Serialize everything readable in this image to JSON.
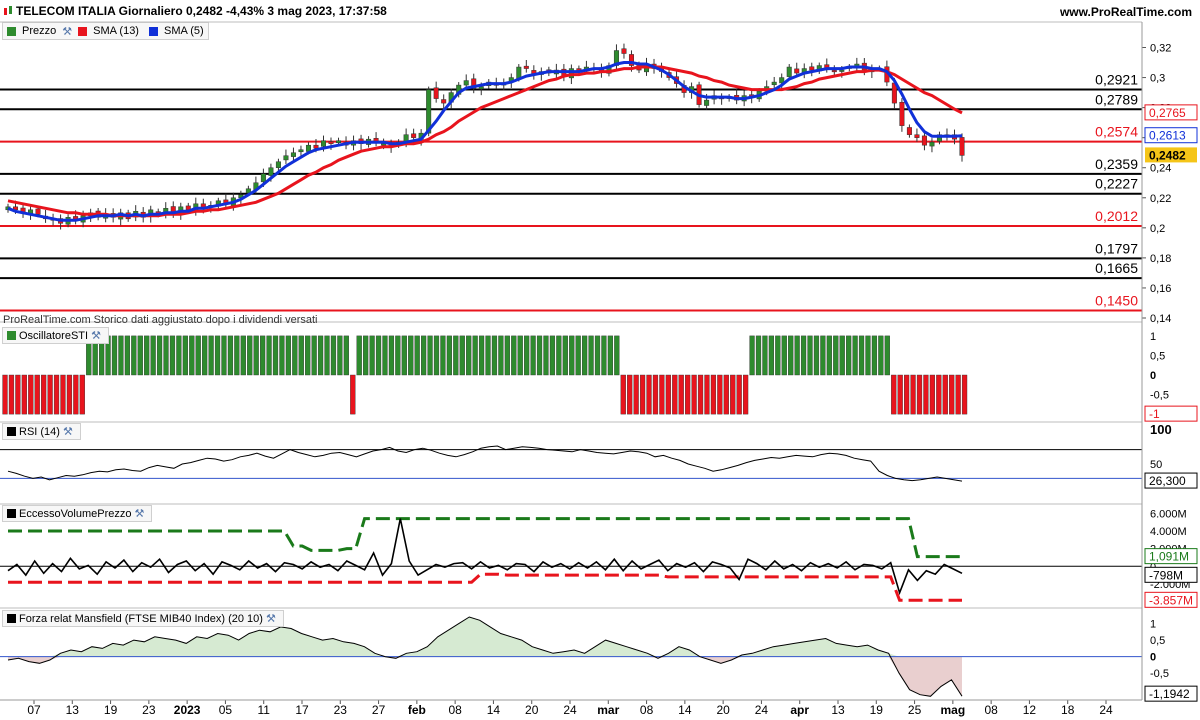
{
  "header": {
    "title": "TELECOM ITALIA Giornaliero 0,2482 -4,43% 3 mag 2023, 17:37:58",
    "site": "www.ProRealTime.com"
  },
  "legend": {
    "items": [
      {
        "label": "Prezzo",
        "color": "#2e8b2e"
      },
      {
        "label": "SMA (13)",
        "color": "#e8141d"
      },
      {
        "label": "SMA (5)",
        "color": "#1030d8"
      }
    ]
  },
  "source_note": "ProRealTime.com Storico dati aggiustato dopo i dividendi versati",
  "panels": {
    "sti": {
      "title": "OscillatoreSTI"
    },
    "rsi": {
      "title": "RSI (14)"
    },
    "volume": {
      "title": "EccessoVolumePrezzo"
    },
    "mansfield": {
      "title": "Forza relat Mansfield (FTSE MIB40 Index) (20 10)"
    }
  },
  "colors": {
    "up": "#2e8b2e",
    "down": "#e8141d",
    "sma13": "#e8141d",
    "sma5": "#1030d8",
    "accent_last": "#f5c518"
  },
  "chart_data": [
    {
      "type": "candlestick",
      "name": "Prezzo",
      "x_ticks": [
        "07",
        "13",
        "19",
        "23",
        "2023",
        "05",
        "11",
        "17",
        "23",
        "27",
        "feb",
        "08",
        "14",
        "20",
        "24",
        "mar",
        "08",
        "14",
        "20",
        "24",
        "apr",
        "13",
        "19",
        "25",
        "mag",
        "08",
        "12",
        "18",
        "24"
      ],
      "y_ticks": [
        "0,32",
        "0,3",
        "0,28",
        "0,26",
        "0,24",
        "0,22",
        "0,2",
        "0,18",
        "0,16",
        "0,14"
      ],
      "ylim": [
        0.14,
        0.325
      ],
      "last_value": "0,2482",
      "sma13_last": "0,2765",
      "sma5_last": "0,2613",
      "levels": [
        {
          "value": 0.2921,
          "label": "0,2921",
          "color": "#000000"
        },
        {
          "value": 0.2789,
          "label": "0,2789",
          "color": "#000000"
        },
        {
          "value": 0.2574,
          "label": "0,2574",
          "color": "#e8141d"
        },
        {
          "value": 0.2359,
          "label": "0,2359",
          "color": "#000000"
        },
        {
          "value": 0.2227,
          "label": "0,2227",
          "color": "#000000"
        },
        {
          "value": 0.2012,
          "label": "0,2012",
          "color": "#e8141d"
        },
        {
          "value": 0.1797,
          "label": "0,1797",
          "color": "#000000"
        },
        {
          "value": 0.1665,
          "label": "0,1665",
          "color": "#000000"
        },
        {
          "value": 0.145,
          "label": "0,1450",
          "color": "#e8141d"
        }
      ],
      "close": [
        0.214,
        0.212,
        0.21,
        0.212,
        0.209,
        0.206,
        0.205,
        0.203,
        0.207,
        0.205,
        0.208,
        0.21,
        0.207,
        0.209,
        0.207,
        0.21,
        0.206,
        0.211,
        0.207,
        0.212,
        0.209,
        0.213,
        0.21,
        0.214,
        0.212,
        0.216,
        0.213,
        0.215,
        0.218,
        0.216,
        0.22,
        0.222,
        0.226,
        0.23,
        0.236,
        0.24,
        0.244,
        0.248,
        0.25,
        0.252,
        0.255,
        0.253,
        0.258,
        0.256,
        0.258,
        0.255,
        0.258,
        0.256,
        0.259,
        0.257,
        0.256,
        0.254,
        0.257,
        0.262,
        0.26,
        0.263,
        0.292,
        0.286,
        0.283,
        0.29,
        0.295,
        0.298,
        0.293,
        0.294,
        0.297,
        0.295,
        0.296,
        0.3,
        0.307,
        0.306,
        0.302,
        0.304,
        0.303,
        0.305,
        0.301,
        0.306,
        0.304,
        0.307,
        0.306,
        0.304,
        0.308,
        0.318,
        0.316,
        0.308,
        0.305,
        0.309,
        0.306,
        0.304,
        0.3,
        0.296,
        0.29,
        0.294,
        0.282,
        0.285,
        0.288,
        0.286,
        0.287,
        0.285,
        0.288,
        0.287,
        0.291,
        0.294,
        0.297,
        0.3,
        0.307,
        0.303,
        0.306,
        0.305,
        0.308,
        0.306,
        0.304,
        0.305,
        0.307,
        0.309,
        0.305,
        0.306,
        0.306,
        0.297,
        0.283,
        0.268,
        0.262,
        0.26,
        0.255,
        0.257,
        0.262,
        0.262,
        0.259,
        0.2482
      ],
      "sma13": [
        0.218,
        0.217,
        0.216,
        0.215,
        0.214,
        0.213,
        0.212,
        0.211,
        0.21,
        0.21,
        0.209,
        0.209,
        0.209,
        0.209,
        0.208,
        0.208,
        0.208,
        0.208,
        0.208,
        0.208,
        0.208,
        0.209,
        0.209,
        0.209,
        0.21,
        0.211,
        0.211,
        0.212,
        0.212,
        0.213,
        0.214,
        0.215,
        0.216,
        0.217,
        0.219,
        0.221,
        0.223,
        0.226,
        0.229,
        0.232,
        0.235,
        0.237,
        0.24,
        0.242,
        0.245,
        0.247,
        0.249,
        0.251,
        0.252,
        0.253,
        0.254,
        0.254,
        0.255,
        0.256,
        0.256,
        0.257,
        0.259,
        0.262,
        0.264,
        0.267,
        0.271,
        0.274,
        0.277,
        0.28,
        0.282,
        0.284,
        0.286,
        0.288,
        0.29,
        0.292,
        0.294,
        0.296,
        0.298,
        0.299,
        0.301,
        0.302,
        0.302,
        0.303,
        0.303,
        0.304,
        0.304,
        0.305,
        0.306,
        0.306,
        0.307,
        0.307,
        0.307,
        0.307,
        0.306,
        0.305,
        0.304,
        0.303,
        0.301,
        0.3,
        0.298,
        0.297,
        0.295,
        0.294,
        0.293,
        0.292,
        0.292,
        0.292,
        0.292,
        0.292,
        0.293,
        0.294,
        0.296,
        0.297,
        0.299,
        0.3,
        0.301,
        0.302,
        0.303,
        0.304,
        0.304,
        0.305,
        0.305,
        0.304,
        0.302,
        0.299,
        0.296,
        0.293,
        0.29,
        0.288,
        0.285,
        0.282,
        0.279,
        0.2765
      ],
      "sma5": [
        0.213,
        0.211,
        0.21,
        0.209,
        0.208,
        0.207,
        0.206,
        0.205,
        0.205,
        0.205,
        0.206,
        0.207,
        0.208,
        0.208,
        0.208,
        0.209,
        0.208,
        0.209,
        0.208,
        0.209,
        0.209,
        0.21,
        0.21,
        0.211,
        0.211,
        0.213,
        0.213,
        0.214,
        0.215,
        0.216,
        0.217,
        0.219,
        0.222,
        0.225,
        0.229,
        0.233,
        0.237,
        0.241,
        0.244,
        0.247,
        0.25,
        0.252,
        0.253,
        0.254,
        0.255,
        0.256,
        0.257,
        0.257,
        0.257,
        0.257,
        0.257,
        0.256,
        0.256,
        0.257,
        0.258,
        0.259,
        0.265,
        0.271,
        0.278,
        0.284,
        0.29,
        0.293,
        0.294,
        0.295,
        0.296,
        0.296,
        0.296,
        0.297,
        0.299,
        0.301,
        0.302,
        0.303,
        0.304,
        0.304,
        0.304,
        0.304,
        0.304,
        0.305,
        0.306,
        0.306,
        0.307,
        0.309,
        0.31,
        0.31,
        0.309,
        0.309,
        0.307,
        0.305,
        0.302,
        0.298,
        0.294,
        0.291,
        0.288,
        0.287,
        0.287,
        0.287,
        0.287,
        0.286,
        0.286,
        0.287,
        0.288,
        0.29,
        0.292,
        0.295,
        0.299,
        0.301,
        0.303,
        0.304,
        0.305,
        0.306,
        0.306,
        0.306,
        0.307,
        0.307,
        0.307,
        0.306,
        0.306,
        0.304,
        0.298,
        0.289,
        0.279,
        0.27,
        0.264,
        0.261,
        0.261,
        0.261,
        0.261,
        0.2613
      ]
    },
    {
      "type": "bar",
      "name": "OscillatoreSTI",
      "y_ticks": [
        "1",
        "0,5",
        "0",
        "-0,5",
        "-1"
      ],
      "ylim": [
        -1.15,
        1.15
      ],
      "last_value": "-1",
      "values": [
        -1,
        -1,
        -1,
        -1,
        -1,
        -1,
        -1,
        -1,
        -1,
        -1,
        -1,
        -1,
        -1,
        1,
        1,
        1,
        1,
        1,
        1,
        1,
        1,
        1,
        1,
        1,
        1,
        1,
        1,
        1,
        1,
        1,
        1,
        1,
        1,
        1,
        1,
        1,
        1,
        1,
        1,
        1,
        1,
        1,
        1,
        1,
        1,
        1,
        1,
        1,
        1,
        1,
        1,
        1,
        1,
        1,
        -1,
        1,
        1,
        1,
        1,
        1,
        1,
        1,
        1,
        1,
        1,
        1,
        1,
        1,
        1,
        1,
        1,
        1,
        1,
        1,
        1,
        1,
        1,
        1,
        1,
        1,
        1,
        1,
        1,
        1,
        1,
        1,
        1,
        1,
        1,
        1,
        1,
        1,
        1,
        1,
        1,
        1,
        -1,
        -1,
        -1,
        -1,
        -1,
        -1,
        -1,
        -1,
        -1,
        -1,
        -1,
        -1,
        -1,
        -1,
        -1,
        -1,
        -1,
        -1,
        -1,
        -1,
        1,
        1,
        1,
        1,
        1,
        1,
        1,
        1,
        1,
        1,
        1,
        1,
        1,
        1,
        1,
        1,
        1,
        1,
        1,
        1,
        1,
        1,
        -1,
        -1,
        -1,
        -1,
        -1,
        -1,
        -1,
        -1,
        -1,
        -1,
        -1,
        -1
      ]
    },
    {
      "type": "line",
      "name": "RSI (14)",
      "y_ticks": [
        "100",
        "50"
      ],
      "ylim": [
        0,
        100
      ],
      "last_value": "26,300",
      "values": [
        40,
        37,
        33,
        30,
        32,
        28,
        31,
        34,
        33,
        35,
        38,
        40,
        39,
        42,
        43,
        41,
        40,
        45,
        48,
        46,
        44,
        50,
        52,
        55,
        58,
        57,
        54,
        56,
        60,
        62,
        65,
        61,
        58,
        64,
        70,
        66,
        63,
        60,
        62,
        65,
        66,
        63,
        60,
        64,
        68,
        70,
        73,
        68,
        66,
        70,
        72,
        69,
        65,
        62,
        60,
        63,
        67,
        72,
        74,
        75,
        70,
        72,
        74,
        73,
        72,
        70,
        69,
        68,
        67,
        70,
        68,
        66,
        65,
        64,
        66,
        68,
        67,
        65,
        60,
        62,
        58,
        55,
        50,
        47,
        44,
        40,
        42,
        45,
        48,
        52,
        55,
        57,
        59,
        58,
        60,
        62,
        61,
        60,
        63,
        65,
        64,
        62,
        58,
        56,
        54,
        40,
        34,
        30,
        28,
        27,
        28,
        30,
        32,
        30,
        28,
        26.3
      ]
    },
    {
      "type": "line",
      "name": "EccessoVolumePrezzo",
      "y_ticks": [
        "6.000M",
        "4.000M",
        "2.000M",
        "0",
        "-2.000M"
      ],
      "ylim": [
        -4.5,
        6.6
      ],
      "upper_last": "1,091M",
      "value_last": "-798M",
      "lower_last": "-3.857M",
      "values": [
        -0.5,
        0.2,
        -1.0,
        0.6,
        -0.8,
        0.3,
        -0.6,
        0.9,
        -0.3,
        0.1,
        -0.9,
        0.5,
        -0.2,
        0.7,
        -0.6,
        0.4,
        -0.1,
        0.8,
        -0.7,
        0.2,
        0.6,
        -0.5,
        0.3,
        -0.9,
        0.5,
        0.1,
        -0.4,
        0.6,
        -0.2,
        0.3,
        -0.6,
        0.4,
        0.2,
        -0.3,
        0.5,
        -0.1,
        0.2,
        -0.5,
        0.6,
        0.1,
        -0.4,
        1.5,
        -1.0,
        0.3,
        5.4,
        0.6,
        -1.0,
        -0.4,
        0.2,
        -0.1,
        0.3,
        0.4,
        -0.3,
        0.5,
        -0.2,
        0.1,
        -0.4,
        0.3,
        0.2,
        -0.6,
        0.5,
        -0.1,
        0.3,
        -0.3,
        0.4,
        -0.2,
        0.5,
        -0.4,
        0.8,
        -0.5,
        0.6,
        -0.3,
        0.2,
        0.7,
        -0.5,
        0.3,
        -0.1,
        0.4,
        -0.6,
        0.5,
        0.2,
        -0.2,
        -1.5,
        0.8,
        0.3,
        -0.4,
        0.6,
        -0.3,
        0.2,
        -0.5,
        0.4,
        -0.1,
        0.3,
        -0.2,
        0.5,
        -0.4,
        0.2,
        0.1,
        -0.3,
        0.4,
        -3.0,
        -0.4,
        -1.6,
        -0.5,
        -0.9,
        0.2,
        -0.3,
        -0.798
      ],
      "upper": [
        4.0,
        4.0,
        4.0,
        4.0,
        4.0,
        4.0,
        4.0,
        4.0,
        4.0,
        4.0,
        4.0,
        4.0,
        4.0,
        4.0,
        4.0,
        4.0,
        4.0,
        4.0,
        4.0,
        4.0,
        4.0,
        4.0,
        4.0,
        4.0,
        4.0,
        4.0,
        4.0,
        4.0,
        4.0,
        4.0,
        4.0,
        4.0,
        2.3,
        2.3,
        1.8,
        1.8,
        1.8,
        1.8,
        2.0,
        2.0,
        5.4,
        5.4,
        5.4,
        5.4,
        5.4,
        5.4,
        5.4,
        5.4,
        5.4,
        5.4,
        5.4,
        5.4,
        5.4,
        5.4,
        5.4,
        5.4,
        5.4,
        5.4,
        5.4,
        5.4,
        5.4,
        5.4,
        5.4,
        5.4,
        5.4,
        5.4,
        5.4,
        5.4,
        5.4,
        5.4,
        5.4,
        5.4,
        5.4,
        5.4,
        5.4,
        5.4,
        5.4,
        5.4,
        5.4,
        5.4,
        5.4,
        5.4,
        5.4,
        5.4,
        5.4,
        5.4,
        5.4,
        5.4,
        5.4,
        5.4,
        5.4,
        5.4,
        5.4,
        5.4,
        5.4,
        5.4,
        5.4,
        5.4,
        5.4,
        5.4,
        5.4,
        5.4,
        1.091,
        1.091,
        1.091,
        1.091,
        1.091,
        1.091
      ],
      "lower": [
        -1.8,
        -1.8,
        -1.8,
        -1.8,
        -1.8,
        -1.8,
        -1.8,
        -1.8,
        -1.8,
        -1.8,
        -1.8,
        -1.8,
        -1.8,
        -1.8,
        -1.8,
        -1.8,
        -1.8,
        -1.8,
        -1.8,
        -1.8,
        -1.8,
        -1.8,
        -1.8,
        -1.8,
        -1.8,
        -1.8,
        -1.8,
        -1.8,
        -1.8,
        -1.8,
        -1.8,
        -1.8,
        -1.8,
        -1.8,
        -1.8,
        -1.8,
        -1.8,
        -1.8,
        -1.8,
        -1.8,
        -1.8,
        -1.8,
        -1.8,
        -1.8,
        -1.8,
        -1.8,
        -1.8,
        -1.8,
        -1.8,
        -1.8,
        -1.8,
        -1.8,
        -1.8,
        -0.9,
        -0.9,
        -0.9,
        -1.0,
        -1.0,
        -1.0,
        -1.0,
        -1.0,
        -1.0,
        -1.0,
        -1.0,
        -1.0,
        -1.0,
        -1.0,
        -1.0,
        -1.0,
        -1.0,
        -1.0,
        -1.0,
        -1.0,
        -1.0,
        -1.2,
        -1.2,
        -1.2,
        -1.2,
        -1.2,
        -1.2,
        -1.2,
        -1.2,
        -1.2,
        -1.2,
        -1.2,
        -1.2,
        -1.2,
        -1.2,
        -1.2,
        -1.2,
        -1.2,
        -1.2,
        -1.2,
        -1.2,
        -1.2,
        -1.2,
        -1.2,
        -1.2,
        -1.2,
        -1.2,
        -3.857,
        -3.857,
        -3.857,
        -3.857,
        -3.857,
        -3.857,
        -3.857,
        -3.857
      ]
    },
    {
      "type": "area",
      "name": "Forza relat Mansfield (FTSE MIB40 Index) (20 10)",
      "y_ticks": [
        "1",
        "0,5",
        "0",
        "-0,5"
      ],
      "ylim": [
        -1.25,
        1.35
      ],
      "last_value": "-1,1942",
      "values": [
        -0.1,
        -0.05,
        -0.15,
        -0.2,
        -0.1,
        0.1,
        0.2,
        0.15,
        0.3,
        0.25,
        0.4,
        0.35,
        0.5,
        0.45,
        0.6,
        0.55,
        0.5,
        0.4,
        0.6,
        0.55,
        0.7,
        0.65,
        0.5,
        0.7,
        0.8,
        0.75,
        0.9,
        0.85,
        0.7,
        0.6,
        0.5,
        0.55,
        0.45,
        0.4,
        0.3,
        0.1,
        0.0,
        -0.05,
        0.1,
        0.15,
        0.3,
        0.6,
        0.8,
        1.0,
        1.2,
        1.1,
        0.9,
        0.7,
        0.6,
        0.5,
        0.3,
        0.2,
        0.1,
        0.15,
        0.2,
        0.1,
        0.3,
        0.5,
        0.4,
        0.3,
        0.2,
        0.1,
        -0.05,
        0.1,
        0.3,
        0.2,
        0.0,
        -0.1,
        -0.2,
        -0.1,
        0.05,
        0.1,
        0.2,
        0.3,
        0.35,
        0.4,
        0.45,
        0.5,
        0.55,
        0.4,
        0.35,
        0.3,
        0.35,
        0.2,
        0.1,
        -0.5,
        -1.0,
        -1.15,
        -1.2,
        -0.9,
        -0.7,
        -1.1942
      ]
    }
  ]
}
